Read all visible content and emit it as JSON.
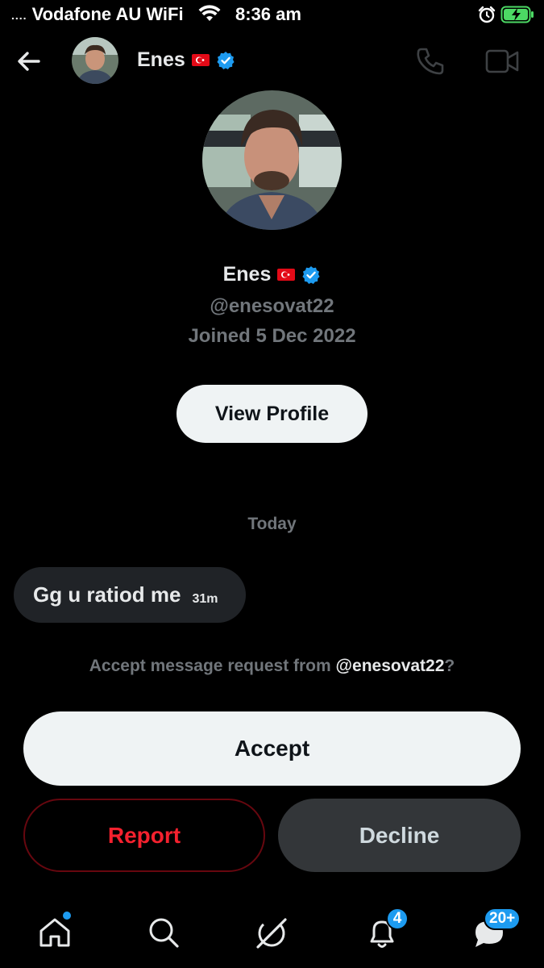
{
  "status_bar": {
    "signal_dots": "....",
    "carrier": "Vodafone AU WiFi",
    "time": "8:36 am"
  },
  "header": {
    "name": "Enes"
  },
  "profile": {
    "name": "Enes",
    "handle": "@enesovat22",
    "joined": "Joined 5 Dec 2022",
    "view_profile_label": "View Profile"
  },
  "conversation": {
    "date_separator": "Today",
    "messages": [
      {
        "text": "Gg u ratiod me",
        "time": "31m"
      }
    ]
  },
  "request": {
    "prefix": "Accept message request from ",
    "handle": "@enesovat22",
    "suffix": "?",
    "accept_label": "Accept",
    "report_label": "Report",
    "decline_label": "Decline"
  },
  "tab_bar": {
    "notifications_badge": "4",
    "messages_badge": "20+"
  },
  "colors": {
    "accent": "#1d9bf0",
    "danger": "#f4212e",
    "battery": "#4cd964"
  }
}
